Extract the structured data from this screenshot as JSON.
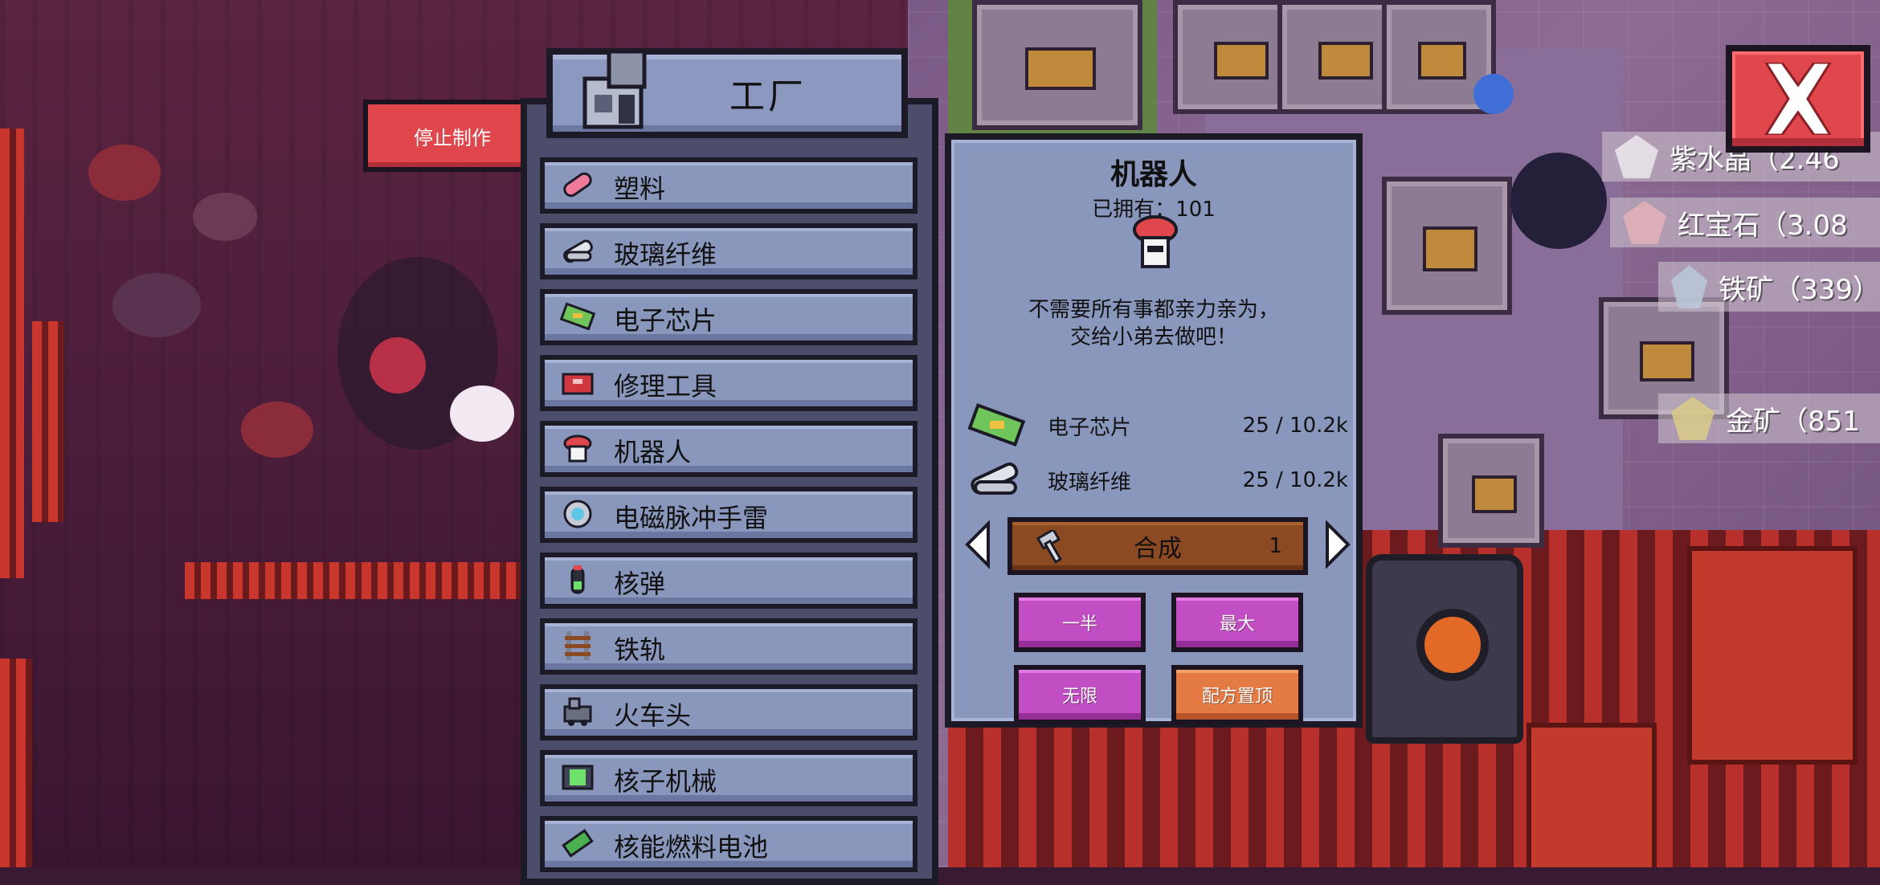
{
  "stop_tab": {
    "label": "停止制作"
  },
  "factory": {
    "title": "工厂",
    "items": [
      {
        "label": "塑料",
        "icon": "plastic-icon"
      },
      {
        "label": "玻璃纤维",
        "icon": "glass-fiber-icon"
      },
      {
        "label": "电子芯片",
        "icon": "chip-icon"
      },
      {
        "label": "修理工具",
        "icon": "repair-kit-icon"
      },
      {
        "label": "机器人",
        "icon": "robot-icon"
      },
      {
        "label": "电磁脉冲手雷",
        "icon": "emp-grenade-icon"
      },
      {
        "label": "核弹",
        "icon": "nuke-icon"
      },
      {
        "label": "铁轨",
        "icon": "rail-icon"
      },
      {
        "label": "火车头",
        "icon": "locomotive-icon"
      },
      {
        "label": "核子机械",
        "icon": "nuclear-machine-icon"
      },
      {
        "label": "核能燃料电池",
        "icon": "fuel-cell-icon"
      }
    ]
  },
  "detail": {
    "title": "机器人",
    "owned": "已拥有：101",
    "description_line1": "不需要所有事都亲力亲为，",
    "description_line2": "交给小弟去做吧！",
    "ingredients": [
      {
        "name": "电子芯片",
        "count": "25 / 10.2k",
        "icon": "chip-icon"
      },
      {
        "name": "玻璃纤维",
        "count": "25 / 10.2k",
        "icon": "glass-fiber-icon"
      }
    ],
    "craft": {
      "label": "合成",
      "quantity": "1"
    },
    "buttons": {
      "half": "一半",
      "max": "最大",
      "infinite": "无限",
      "pin_recipe": "配方置顶"
    }
  },
  "resources": [
    {
      "label": "紫水晶（2.46",
      "icon": "amethyst-icon"
    },
    {
      "label": "红宝石（3.08",
      "icon": "ruby-icon"
    },
    {
      "label": "铁矿（339）",
      "icon": "iron-ore-icon"
    },
    {
      "label": "金矿（851",
      "icon": "gold-ore-icon"
    }
  ],
  "colors": {
    "panel": "#8a97bd",
    "panel_dark": "#4b4d6a",
    "close_red": "#e0474c",
    "craft_brown": "#8b4a22",
    "pink_button": "#c24ec4",
    "orange_button": "#e47a44"
  }
}
